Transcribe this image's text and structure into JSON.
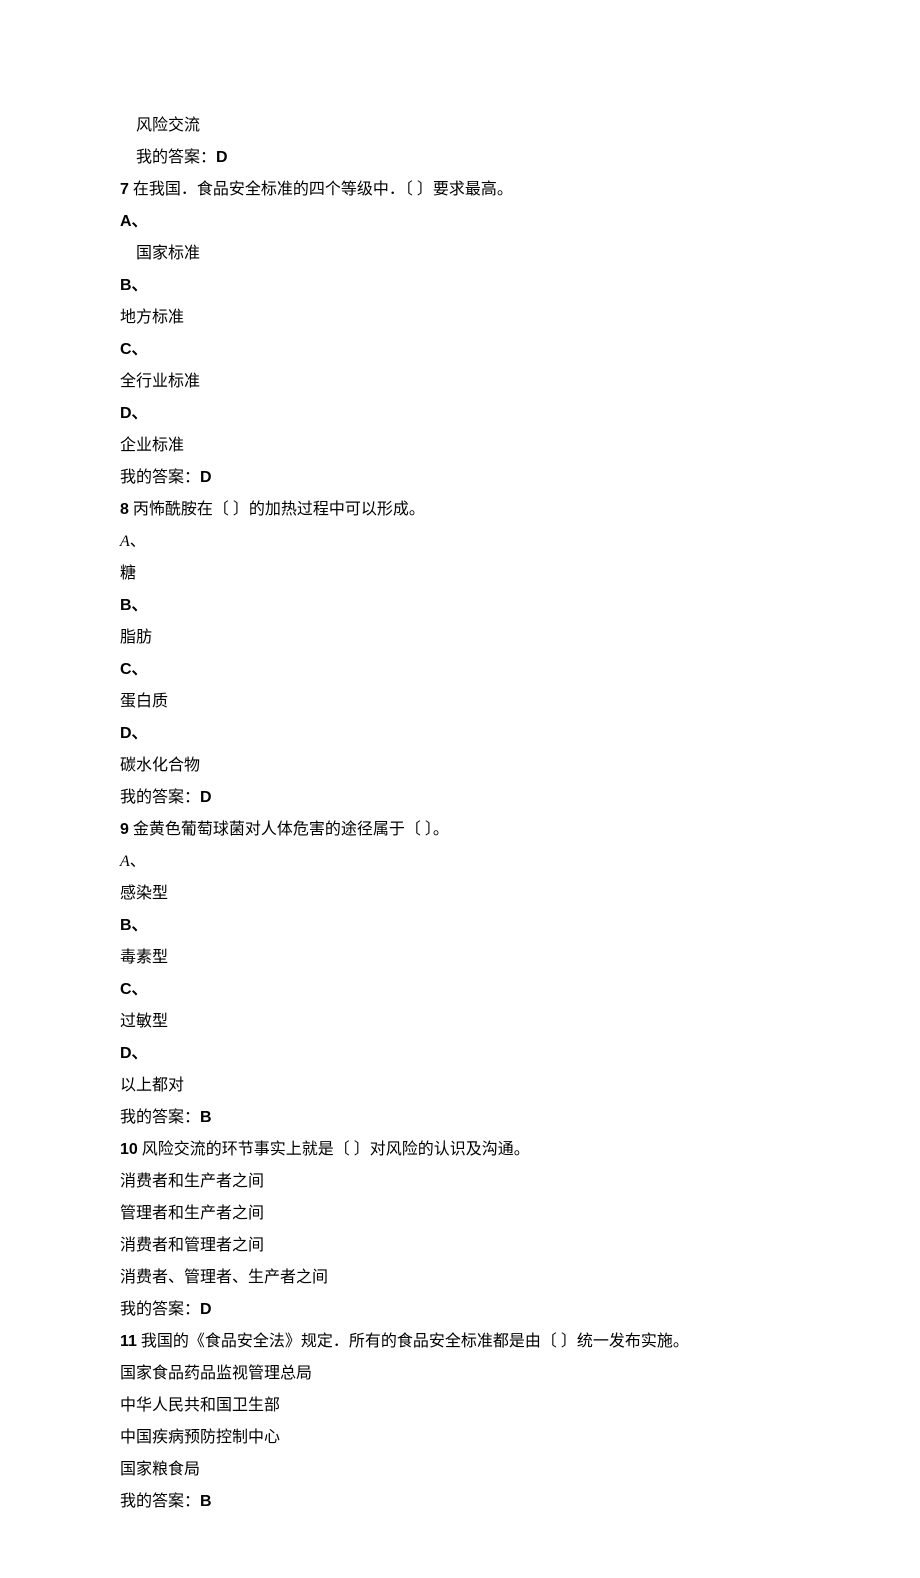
{
  "q6": {
    "optD": "风险交流",
    "ansLabel": "我的答案：",
    "ans": "D"
  },
  "q7": {
    "num": "7",
    "stem": " 在我国．食品安全标准的四个等级中．〔 〕要求最高。",
    "A": "A、",
    "optA": "国家标准",
    "B": "B、",
    "optB": "地方标准",
    "C": "C、",
    "optC": "全行业标准",
    "D": "D、",
    "optD": "企业标准",
    "ansLabel": "我的答案：",
    "ans": "D"
  },
  "q8": {
    "num": "8",
    "stem": " 丙怖酰胺在〔 〕的加热过程中可以形成。",
    "A": "A",
    "Apunct": "、",
    "optA": "糖",
    "B": "B、",
    "optB": "脂肪",
    "C": "C、",
    "optC": "蛋白质",
    "D": "D、",
    "optD": "碳水化合物",
    "ansLabel": "我的答案：",
    "ans": "D"
  },
  "q9": {
    "num": "9",
    "stem": " 金黄色葡萄球菌对人体危害的途径属于〔 〕。",
    "A": "A",
    "Apunct": "、",
    "optA": "感染型",
    "B": "B、",
    "optB": "毒素型",
    "C": "C、",
    "optC": "过敏型",
    "D": "D、",
    "optD": "以上都对",
    "ansLabel": "我的答案：",
    "ans": "B"
  },
  "q10": {
    "num": "10",
    "stem": " 风险交流的环节事实上就是〔 〕对风险的认识及沟通。",
    "optA": "消费者和生产者之间",
    "optB": "管理者和生产者之间",
    "optC": "消费者和管理者之间",
    "optD": "消费者、管理者、生产者之间",
    "ansLabel": "我的答案：",
    "ans": "D"
  },
  "q11": {
    "num": "11",
    "stem": " 我国的《食品安全法》规定．所有的食品安全标准都是由〔 〕统一发布实施。",
    "optA": "国家食品药品监视管理总局",
    "optB": "中华人民共和国卫生部",
    "optC": "中国疾病预防控制中心",
    "optD": "国家粮食局",
    "ansLabel": "我的答案：",
    "ans": "B"
  }
}
